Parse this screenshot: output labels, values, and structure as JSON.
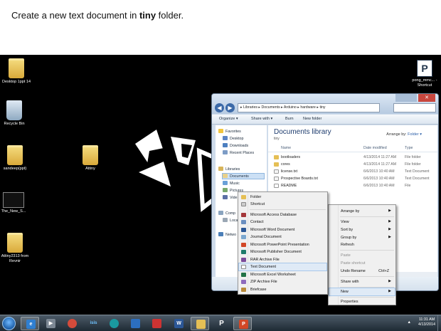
{
  "instruction": {
    "prefix": "Create a new text document in ",
    "bold": "tiny",
    "suffix": " folder."
  },
  "desktop": {
    "icons": [
      {
        "label": "Desktop 1ppt 14",
        "icon": "folder-icon"
      },
      {
        "label": "Recycle Bin",
        "icon": "recycle-bin-icon"
      },
      {
        "label": "sandeep(ppt)",
        "icon": "folder-icon"
      },
      {
        "label": "Attiny",
        "icon": "folder-icon"
      },
      {
        "label": "The_New_S...",
        "icon": "shortcut-icon"
      },
      {
        "label": "Attiny2313 from Revnir",
        "icon": "folder-icon"
      },
      {
        "label": "pong_mmc... - Shortcut",
        "icon": "p-app-icon"
      }
    ]
  },
  "explorer": {
    "address": [
      "Libraries",
      "Documents",
      "Arduino",
      "hardware",
      "tiny"
    ],
    "toolbar": {
      "organize": "Organize ▾",
      "share": "Share with ▾",
      "burn": "Burn",
      "new_folder": "New folder"
    },
    "nav": {
      "favorites": "Favorites",
      "desktop": "Desktop",
      "downloads": "Downloads",
      "recent": "Recent Places",
      "libraries": "Libraries",
      "documents": "Documents",
      "music": "Music",
      "pictures": "Pictures",
      "videos": "Vide",
      "computer": "Comp",
      "local": "Loca",
      "network": "Netwo"
    },
    "library_title": "Documents library",
    "library_sub": "tiny",
    "arrange_by": "Arrange by:",
    "arrange_value": "Folder ▾",
    "columns": {
      "name": "Name",
      "date": "Date modified",
      "type": "Type"
    },
    "files": [
      {
        "name": "bootloaders",
        "date": "4/13/2014 11:27 AM",
        "type": "File folder",
        "kind": "folder"
      },
      {
        "name": "cores",
        "date": "4/13/2014 11:27 AM",
        "type": "File folder",
        "kind": "folder"
      },
      {
        "name": "license.txt",
        "date": "6/6/2013 10:40 AM",
        "type": "Text Document",
        "kind": "text"
      },
      {
        "name": "Prospective Boards.txt",
        "date": "6/6/2013 10:40 AM",
        "type": "Text Document",
        "kind": "text"
      },
      {
        "name": "README",
        "date": "6/6/2013 10:40 AM",
        "type": "File",
        "kind": "file"
      }
    ]
  },
  "context_menu": {
    "items": [
      {
        "label": "Arrange by",
        "submenu": true
      },
      {
        "label": "View",
        "submenu": true
      },
      {
        "label": "Sort by",
        "submenu": true
      },
      {
        "label": "Group by",
        "submenu": true
      },
      {
        "label": "Refresh"
      },
      {
        "label": "Paste",
        "disabled": true
      },
      {
        "label": "Paste shortcut",
        "disabled": true
      },
      {
        "label": "Undo Rename",
        "shortcut": "Ctrl+Z"
      },
      {
        "label": "Share with",
        "submenu": true
      },
      {
        "label": "New",
        "submenu": true,
        "highlighted": true
      },
      {
        "label": "Properties"
      }
    ]
  },
  "new_submenu": {
    "items": [
      {
        "label": "Folder",
        "icon": "folder-icon"
      },
      {
        "label": "Shortcut",
        "icon": "shortcut-icon"
      },
      {
        "label": "Microsoft Access Database",
        "icon": "access-icon"
      },
      {
        "label": "Contact",
        "icon": "contact-icon"
      },
      {
        "label": "Microsoft Word Document",
        "icon": "word-icon"
      },
      {
        "label": "Journal Document",
        "icon": "journal-icon"
      },
      {
        "label": "Microsoft PowerPoint Presentation",
        "icon": "powerpoint-icon"
      },
      {
        "label": "Microsoft Publisher Document",
        "icon": "publisher-icon"
      },
      {
        "label": "RAR Archive File",
        "icon": "rar-icon"
      },
      {
        "label": "Text Document",
        "icon": "text-document-icon",
        "highlighted": true
      },
      {
        "label": "Microsoft Excel Worksheet",
        "icon": "excel-icon"
      },
      {
        "label": "ZIP Archive File",
        "icon": "zip-icon"
      },
      {
        "label": "Briefcase",
        "icon": "briefcase-icon"
      }
    ]
  },
  "taskbar": {
    "time": "11:31 AM",
    "date": "4/13/2014",
    "isis_label": "isis",
    "p_label": "P",
    "tray_arrow": "▲"
  },
  "colors": {
    "desktop": "#000000",
    "menu_highlight": "#dfeaf6",
    "library_title": "#1e3c6e"
  }
}
